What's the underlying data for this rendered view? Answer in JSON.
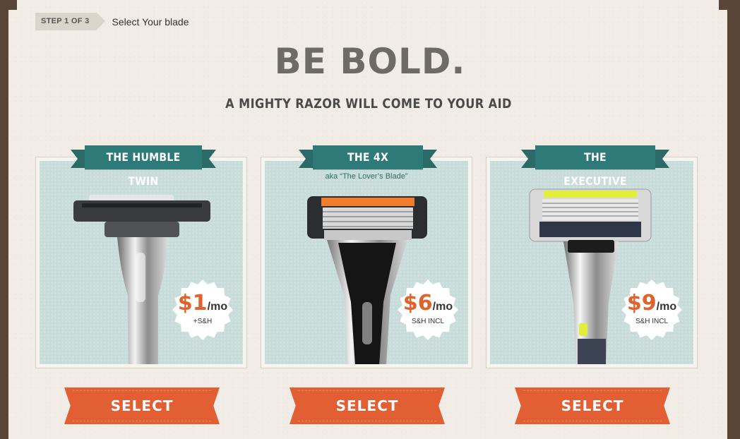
{
  "step": {
    "badge": "STEP 1 OF 3",
    "label": "Select Your blade"
  },
  "headline": "BE BOLD.",
  "subhead": "A MIGHTY RAZOR WILL COME TO YOUR AID",
  "colors": {
    "accent": "#e15f33",
    "ribbon": "#2e7a78",
    "card_bg": "#c8dcda"
  },
  "products": [
    {
      "name": "THE HUMBLE TWIN",
      "aka": "",
      "price": "$1",
      "unit": "/mo",
      "note": "+S&H",
      "select": "SELECT",
      "icon": "twin-blade-razor-icon"
    },
    {
      "name": "THE 4X",
      "aka": "aka “The Lover’s Blade”",
      "price": "$6",
      "unit": "/mo",
      "note": "S&H INCL",
      "select": "SELECT",
      "icon": "four-blade-razor-icon"
    },
    {
      "name": "THE EXECUTIVE",
      "aka": "",
      "price": "$9",
      "unit": "/mo",
      "note": "S&H INCL",
      "select": "SELECT",
      "icon": "executive-razor-icon"
    }
  ]
}
